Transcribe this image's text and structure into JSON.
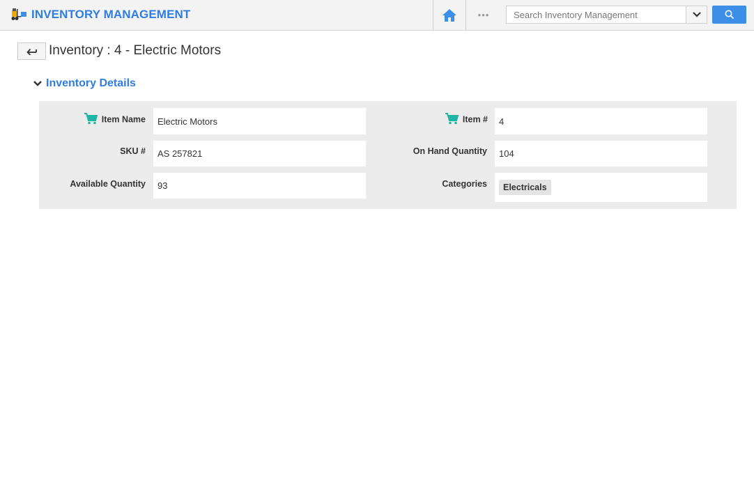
{
  "header": {
    "app_title": "INVENTORY MANAGEMENT",
    "more_label": "•••",
    "search": {
      "placeholder": "Search Inventory Management"
    }
  },
  "page": {
    "title": "Inventory : 4 - Electric Motors"
  },
  "section": {
    "title": "Inventory Details",
    "fields": {
      "item_name": {
        "label": "Item Name",
        "value": "Electric Motors"
      },
      "item_number": {
        "label": "Item #",
        "value": "4"
      },
      "sku": {
        "label": "SKU #",
        "value": "AS 257821"
      },
      "on_hand": {
        "label": "On Hand Quantity",
        "value": "104"
      },
      "available": {
        "label": "Available Quantity",
        "value": "93"
      },
      "categories": {
        "label": "Categories",
        "items": [
          "Electricals"
        ]
      }
    }
  },
  "colors": {
    "accent": "#2f7de1",
    "search_button": "#3c8ee6",
    "cart_icon": "#1fb5a3",
    "panel_bg": "#ececec"
  },
  "icons": [
    "forklift-logo-icon",
    "home-icon",
    "chevron-down-icon",
    "search-icon",
    "back-arrow-icon",
    "cart-icon"
  ]
}
